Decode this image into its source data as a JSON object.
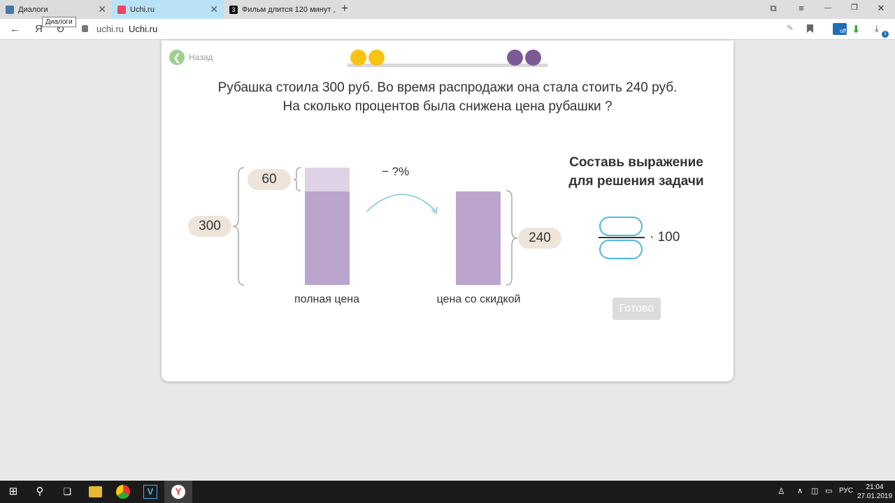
{
  "browser": {
    "tabs": [
      {
        "title": "Диалоги",
        "active": false,
        "favicon_color": "#4a76a8"
      },
      {
        "title": "Uchi.ru",
        "active": true,
        "favicon_color": "#e84a5f"
      },
      {
        "title": "Фильм длится 120 минут ,",
        "active": false,
        "favicon_color": "#111111"
      }
    ],
    "new_tab_label": "+",
    "tooltip": "Диалоги",
    "address": {
      "domain": "uchi.ru",
      "page_title": "Uchi.ru"
    },
    "nav_glyphs": {
      "back": "←",
      "yandex": "Я",
      "reload": "↻"
    },
    "window_glyphs": {
      "collections": "⧉",
      "menu": "≡",
      "minimize": "—",
      "restore": "❐",
      "close": "✕"
    },
    "right_icons": {
      "edit": "✎",
      "bookmark": "🔖",
      "extension": "off",
      "download": "⬇",
      "download_count": "1"
    }
  },
  "lesson": {
    "back_label": "Назад",
    "back_glyph": "❮",
    "progress_dots": [
      {
        "color": "#f9c315"
      },
      {
        "color": "#f9c315"
      },
      {
        "color": "#7b5a96"
      },
      {
        "color": "#7b5a96"
      }
    ],
    "question_line1": "Рубашка стоила 300 руб. Во время распродажи она стала стоить 240 руб.",
    "question_line2": "На сколько процентов была снижена цена рубашки ?",
    "diagram": {
      "total_label": "300",
      "difference_label": "60",
      "discount_label": "240",
      "arrow_label": "− ?%",
      "full_price_caption": "полная цена",
      "discount_price_caption": "цена со скидкой",
      "full_price_value": 300,
      "discount_price_value": 240,
      "colors": {
        "bar": "#bca5cc",
        "bar_light": "#dfd2e6",
        "pill": "#eee4da",
        "arrow": "#7ec3e2"
      }
    },
    "task_title_line1": "Составь выражение",
    "task_title_line2": "для решения задачи",
    "multiplier": "· 100",
    "numerator_value": "",
    "denominator_value": "",
    "done_label": "Готово"
  },
  "taskbar": {
    "start_glyph": "⊞",
    "search_glyph": "⚲",
    "taskview_glyph": "❏",
    "apps": [
      "explorer",
      "chrome",
      "vbox",
      "yandex"
    ],
    "tray": {
      "lang": "РУС",
      "time": "21:04",
      "date": "27.01.2019"
    }
  }
}
